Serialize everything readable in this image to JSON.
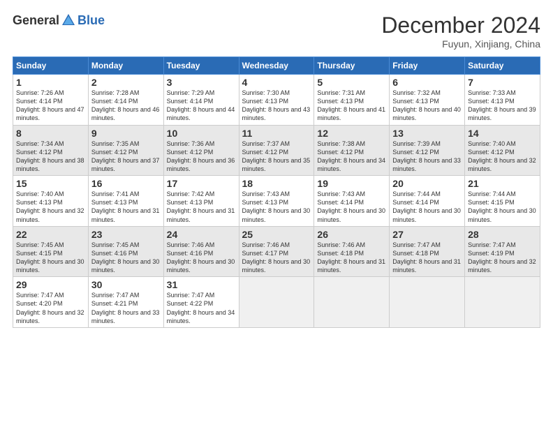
{
  "logo": {
    "general": "General",
    "blue": "Blue"
  },
  "header": {
    "month": "December 2024",
    "location": "Fuyun, Xinjiang, China"
  },
  "weekdays": [
    "Sunday",
    "Monday",
    "Tuesday",
    "Wednesday",
    "Thursday",
    "Friday",
    "Saturday"
  ],
  "weeks": [
    [
      {
        "day": "1",
        "sunrise": "7:26 AM",
        "sunset": "4:14 PM",
        "daylight": "8 hours and 47 minutes."
      },
      {
        "day": "2",
        "sunrise": "7:28 AM",
        "sunset": "4:14 PM",
        "daylight": "8 hours and 46 minutes."
      },
      {
        "day": "3",
        "sunrise": "7:29 AM",
        "sunset": "4:14 PM",
        "daylight": "8 hours and 44 minutes."
      },
      {
        "day": "4",
        "sunrise": "7:30 AM",
        "sunset": "4:13 PM",
        "daylight": "8 hours and 43 minutes."
      },
      {
        "day": "5",
        "sunrise": "7:31 AM",
        "sunset": "4:13 PM",
        "daylight": "8 hours and 41 minutes."
      },
      {
        "day": "6",
        "sunrise": "7:32 AM",
        "sunset": "4:13 PM",
        "daylight": "8 hours and 40 minutes."
      },
      {
        "day": "7",
        "sunrise": "7:33 AM",
        "sunset": "4:13 PM",
        "daylight": "8 hours and 39 minutes."
      }
    ],
    [
      {
        "day": "8",
        "sunrise": "7:34 AM",
        "sunset": "4:12 PM",
        "daylight": "8 hours and 38 minutes."
      },
      {
        "day": "9",
        "sunrise": "7:35 AM",
        "sunset": "4:12 PM",
        "daylight": "8 hours and 37 minutes."
      },
      {
        "day": "10",
        "sunrise": "7:36 AM",
        "sunset": "4:12 PM",
        "daylight": "8 hours and 36 minutes."
      },
      {
        "day": "11",
        "sunrise": "7:37 AM",
        "sunset": "4:12 PM",
        "daylight": "8 hours and 35 minutes."
      },
      {
        "day": "12",
        "sunrise": "7:38 AM",
        "sunset": "4:12 PM",
        "daylight": "8 hours and 34 minutes."
      },
      {
        "day": "13",
        "sunrise": "7:39 AM",
        "sunset": "4:12 PM",
        "daylight": "8 hours and 33 minutes."
      },
      {
        "day": "14",
        "sunrise": "7:40 AM",
        "sunset": "4:12 PM",
        "daylight": "8 hours and 32 minutes."
      }
    ],
    [
      {
        "day": "15",
        "sunrise": "7:40 AM",
        "sunset": "4:13 PM",
        "daylight": "8 hours and 32 minutes."
      },
      {
        "day": "16",
        "sunrise": "7:41 AM",
        "sunset": "4:13 PM",
        "daylight": "8 hours and 31 minutes."
      },
      {
        "day": "17",
        "sunrise": "7:42 AM",
        "sunset": "4:13 PM",
        "daylight": "8 hours and 31 minutes."
      },
      {
        "day": "18",
        "sunrise": "7:43 AM",
        "sunset": "4:13 PM",
        "daylight": "8 hours and 30 minutes."
      },
      {
        "day": "19",
        "sunrise": "7:43 AM",
        "sunset": "4:14 PM",
        "daylight": "8 hours and 30 minutes."
      },
      {
        "day": "20",
        "sunrise": "7:44 AM",
        "sunset": "4:14 PM",
        "daylight": "8 hours and 30 minutes."
      },
      {
        "day": "21",
        "sunrise": "7:44 AM",
        "sunset": "4:15 PM",
        "daylight": "8 hours and 30 minutes."
      }
    ],
    [
      {
        "day": "22",
        "sunrise": "7:45 AM",
        "sunset": "4:15 PM",
        "daylight": "8 hours and 30 minutes."
      },
      {
        "day": "23",
        "sunrise": "7:45 AM",
        "sunset": "4:16 PM",
        "daylight": "8 hours and 30 minutes."
      },
      {
        "day": "24",
        "sunrise": "7:46 AM",
        "sunset": "4:16 PM",
        "daylight": "8 hours and 30 minutes."
      },
      {
        "day": "25",
        "sunrise": "7:46 AM",
        "sunset": "4:17 PM",
        "daylight": "8 hours and 30 minutes."
      },
      {
        "day": "26",
        "sunrise": "7:46 AM",
        "sunset": "4:18 PM",
        "daylight": "8 hours and 31 minutes."
      },
      {
        "day": "27",
        "sunrise": "7:47 AM",
        "sunset": "4:18 PM",
        "daylight": "8 hours and 31 minutes."
      },
      {
        "day": "28",
        "sunrise": "7:47 AM",
        "sunset": "4:19 PM",
        "daylight": "8 hours and 32 minutes."
      }
    ],
    [
      {
        "day": "29",
        "sunrise": "7:47 AM",
        "sunset": "4:20 PM",
        "daylight": "8 hours and 32 minutes."
      },
      {
        "day": "30",
        "sunrise": "7:47 AM",
        "sunset": "4:21 PM",
        "daylight": "8 hours and 33 minutes."
      },
      {
        "day": "31",
        "sunrise": "7:47 AM",
        "sunset": "4:22 PM",
        "daylight": "8 hours and 34 minutes."
      },
      null,
      null,
      null,
      null
    ]
  ],
  "labels": {
    "sunrise": "Sunrise:",
    "sunset": "Sunset:",
    "daylight": "Daylight:"
  }
}
